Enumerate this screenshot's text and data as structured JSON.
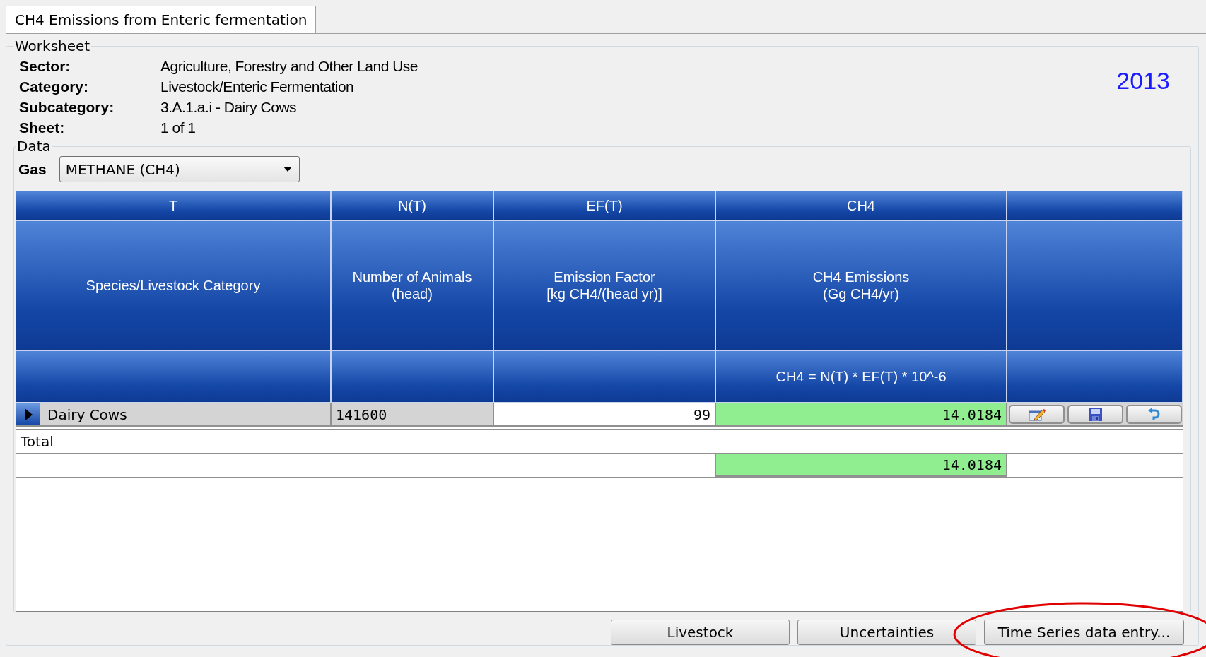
{
  "tab": {
    "label": "CH4 Emissions from Enteric fermentation",
    "selected": true
  },
  "worksheet": {
    "title": "Worksheet",
    "year": "2013",
    "fields": [
      {
        "label": "Sector:",
        "value": "Agriculture, Forestry and Other Land Use"
      },
      {
        "label": "Category:",
        "value": "Livestock/Enteric Fermentation"
      },
      {
        "label": "Subcategory:",
        "value": "3.A.1.a.i - Dairy Cows"
      },
      {
        "label": "Sheet:",
        "value": "1 of 1"
      }
    ]
  },
  "data": {
    "title": "Data",
    "gas": {
      "label": "Gas",
      "value": "METHANE (CH4)"
    }
  },
  "table": {
    "columns": [
      {
        "code": "T",
        "heading": "Species/Livestock Category"
      },
      {
        "code": "N(T)",
        "heading": "Number of Animals\n(head)"
      },
      {
        "code": "EF(T)",
        "heading": "Emission Factor\n[kg CH4/(head yr)]"
      },
      {
        "code": "CH4",
        "heading": "CH4 Emissions\n(Gg CH4/yr)",
        "formula": "CH4 = N(T) * EF(T) * 10^-6"
      }
    ],
    "rows": [
      {
        "current": true,
        "cells": [
          {
            "kind": "readonly",
            "text": "Dairy Cows"
          },
          {
            "kind": "readonly",
            "text": "141600"
          },
          {
            "kind": "input",
            "text": "99"
          },
          {
            "kind": "computed",
            "text": "14.0184"
          }
        ],
        "actions": [
          {
            "kind": "edit"
          },
          {
            "kind": "save"
          },
          {
            "kind": "undo"
          }
        ]
      }
    ],
    "total": {
      "label": "Total",
      "value": "14.0184"
    }
  },
  "buttons": [
    {
      "label": "Livestock"
    },
    {
      "label": "Uncertainties"
    },
    {
      "label": "Time Series data entry..."
    }
  ],
  "annotations": [
    {
      "kind": "ellipse"
    }
  ]
}
